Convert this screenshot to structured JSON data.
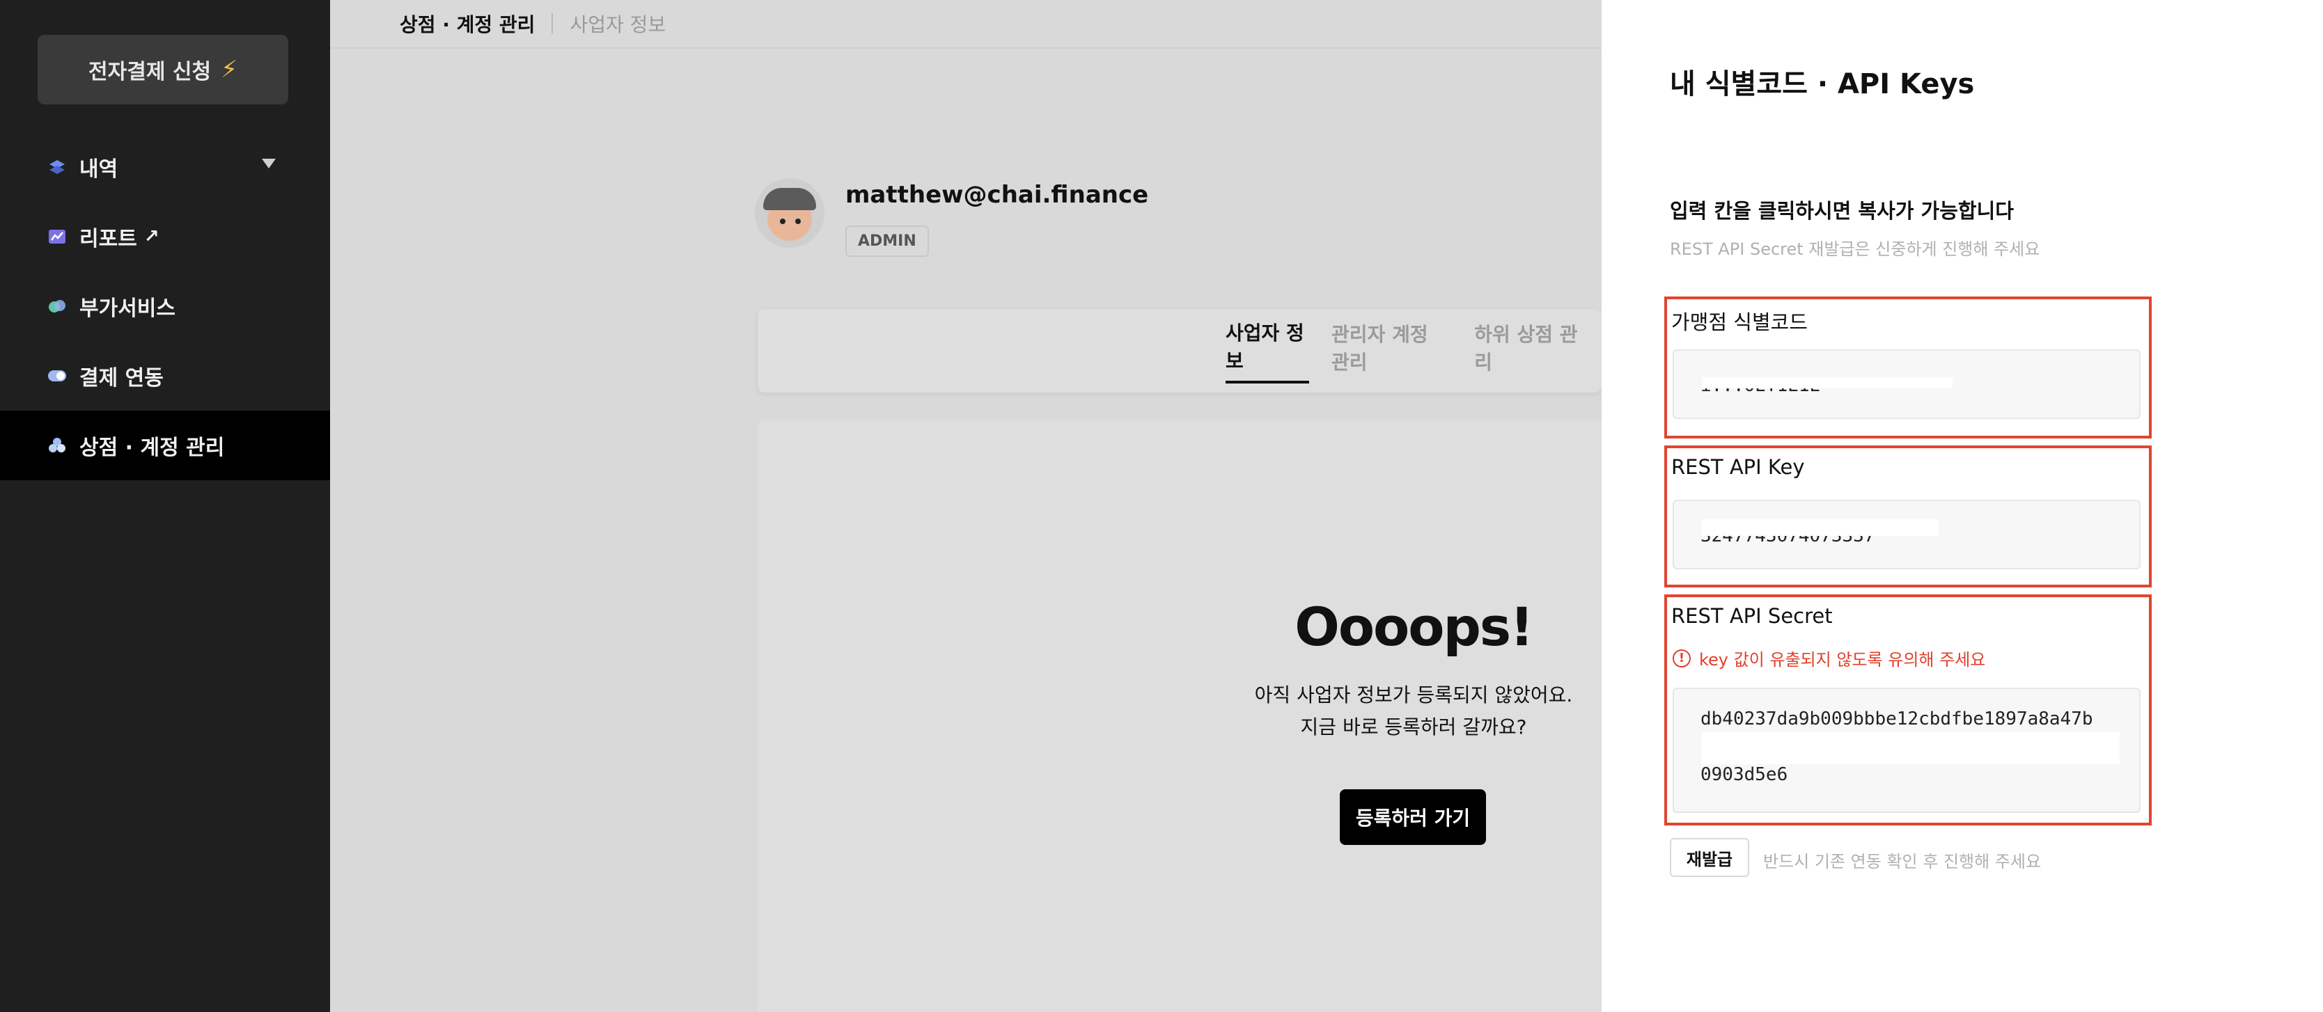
{
  "sidebar": {
    "apply_label": "전자결제 신청",
    "items": [
      {
        "label": "내역",
        "icon": "layers-icon"
      },
      {
        "label": "리포트",
        "icon": "chart-icon"
      },
      {
        "label": "부가서비스",
        "icon": "services-icon"
      },
      {
        "label": "결제 연동",
        "icon": "toggle-icon"
      },
      {
        "label": "상점 · 계정 관리",
        "icon": "users-icon"
      }
    ]
  },
  "topbar": {
    "active": "상점 · 계정 관리",
    "inactive": "사업자 정보"
  },
  "profile": {
    "email": "matthew@chai.finance",
    "role": "ADMIN"
  },
  "tabs": [
    "사업자 정보",
    "관리자 계정 관리",
    "하위 상점 관리"
  ],
  "empty_state": {
    "title": "Oooops!",
    "line1": "아직 사업자 정보가 등록되지 않았어요.",
    "line2": "지금 바로 등록하러 갈까요?",
    "cta": "등록하러 가기"
  },
  "panel": {
    "title": "내 식별코드 · API Keys",
    "subtitle": "입력 칸을 클릭하시면 복사가 가능합니다",
    "hint": "REST API Secret 재발급은 신중하게 진행해 주세요",
    "merchant_label": "가맹점 식별코드",
    "merchant_value": "i...0ET1E1E",
    "api_key_label": "REST API Key",
    "api_key_value": "3247743074073337",
    "secret_label": "REST API Secret",
    "secret_warning": "key 값이 유출되지 않도록 유의해 주세요",
    "secret_value_line1": "db40237da9b009bbbe12cbdfbe1897a8a47b",
    "secret_value_line2": "0903d5e6",
    "reissue_label": "재발급",
    "reissue_hint": "반드시 기존 연동 확인 후 진행해 주세요"
  },
  "colors": {
    "accent_red": "#e0452f",
    "sidebar_bg": "#1f1f1f"
  }
}
